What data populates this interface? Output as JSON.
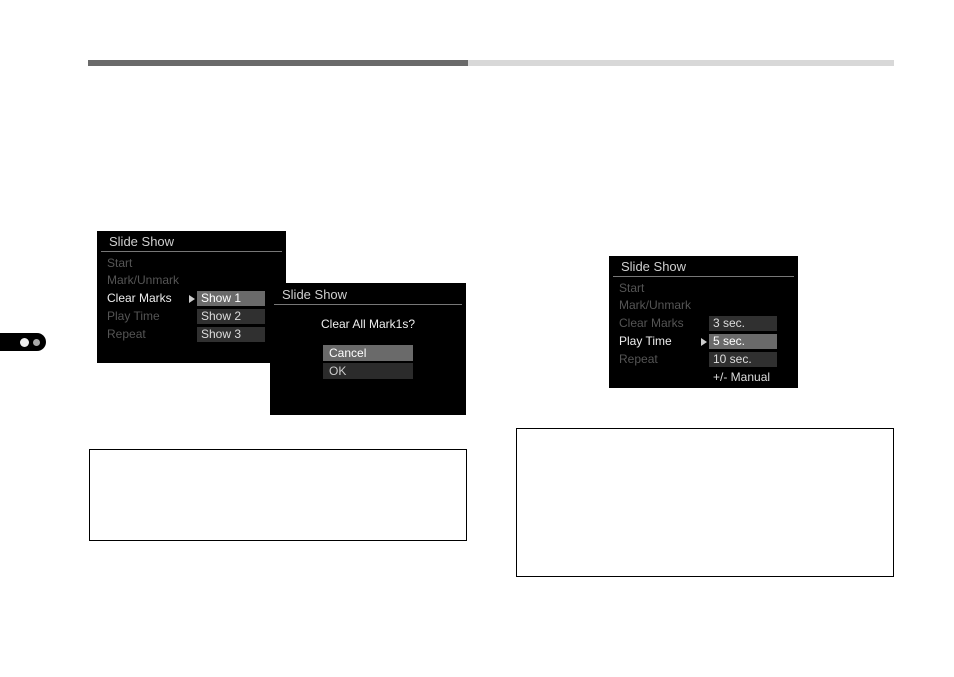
{
  "panelA": {
    "title": "Slide Show",
    "items": [
      "Start",
      "Mark/Unmark",
      "Clear Marks",
      "Play Time",
      "Repeat"
    ],
    "activeIndex": 2,
    "options": [
      "Show 1",
      "Show 2",
      "Show 3"
    ],
    "selectedOption": 0
  },
  "dialog": {
    "title": "Slide Show",
    "message": "Clear All Mark1s?",
    "buttons": [
      "Cancel",
      "OK"
    ],
    "selected": 0
  },
  "panelB": {
    "title": "Slide Show",
    "items": [
      "Start",
      "Mark/Unmark",
      "Clear Marks",
      "Play Time",
      "Repeat"
    ],
    "activeIndex": 3,
    "options": [
      "3 sec.",
      "5 sec.",
      "10 sec.",
      "+/- Manual"
    ],
    "selectedOption": 1
  }
}
